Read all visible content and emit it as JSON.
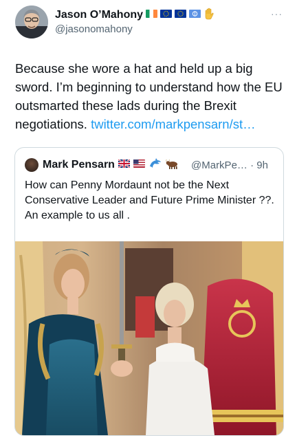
{
  "tweet": {
    "author_name": "Jason O’Mahony",
    "handle": "@jasonomahony",
    "name_emojis": [
      "flag-ireland-icon",
      "flag-eu-icon",
      "flag-eu-icon",
      "flag-un-icon",
      "raised-hand-icon"
    ],
    "text_before_link": "Because she wore a hat and held up a big sword. I’m beginning to understand how the EU outsmarted these lads during the Brexit negotiations. ",
    "link_text": "twitter.com/markpensarn/st…",
    "more_label": "···"
  },
  "quoted_tweet": {
    "author_name": "Mark Pensarn",
    "name_emojis": [
      "flag-uk-icon",
      "flag-us-icon",
      "dolphin-icon",
      "ox-icon"
    ],
    "handle": "@MarkPe…",
    "separator": "·",
    "timestamp": "9h",
    "text_line1": "How can Penny Mordaunt not be the Next Conservative Leader and Future Prime Minister ??.",
    "text_line2": "An example to us all ."
  },
  "colors": {
    "text": "#0f1419",
    "secondary": "#536471",
    "link": "#1d9bf0",
    "border": "#cfd9de",
    "throne_red": "#b5233a",
    "dress_teal": "#1f5f7a"
  }
}
